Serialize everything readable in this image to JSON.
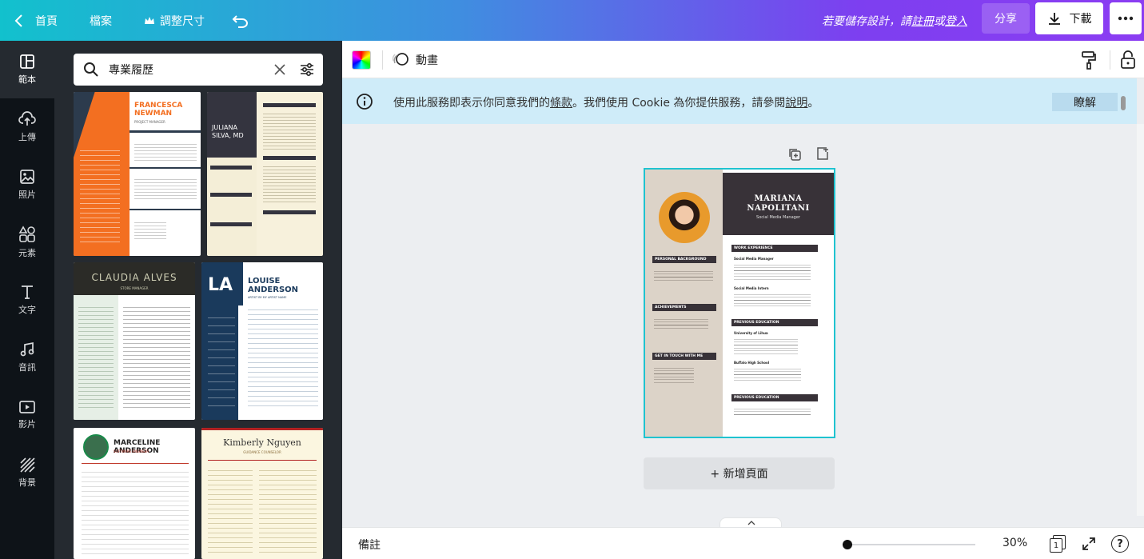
{
  "topbar": {
    "home_label": "首頁",
    "file_label": "檔案",
    "resize_label": "調整尺寸",
    "save_prompt": "若要儲存設計，請",
    "register_label": "註冊",
    "or_label": " 或",
    "login_label": "登入",
    "share_label": "分享",
    "download_label": "下載"
  },
  "rail": {
    "items": [
      {
        "label": "範本",
        "icon": "template-icon"
      },
      {
        "label": "上傳",
        "icon": "upload-icon"
      },
      {
        "label": "照片",
        "icon": "photo-icon"
      },
      {
        "label": "元素",
        "icon": "elements-icon"
      },
      {
        "label": "文字",
        "icon": "text-icon"
      },
      {
        "label": "音訊",
        "icon": "audio-icon"
      },
      {
        "label": "影片",
        "icon": "video-icon"
      },
      {
        "label": "背景",
        "icon": "background-icon"
      }
    ]
  },
  "search": {
    "value": "專業履歷"
  },
  "templates": {
    "t1": {
      "name1": "FRANCESCA",
      "name2": "NEWMAN",
      "role": "PROJECT MANAGER",
      "accent": "#f36f21"
    },
    "t2": {
      "name1": "JULIANA",
      "name2": "SILVA, MD"
    },
    "t3": {
      "name": "CLAUDIA ALVES",
      "role": "STORE MANAGER"
    },
    "t4": {
      "initials": "LA",
      "name1": "LOUISE",
      "name2": "ANDERSON",
      "role": "ARTIST BY MY ARTIST NAME"
    },
    "t5": {
      "name": "MARCELINE ANDERSON",
      "role": "SOFTWARE ENGINEER"
    },
    "t6": {
      "name": "Kimberly Nguyen",
      "role": "GUIDANCE COUNSELOR"
    }
  },
  "toolbar": {
    "animate_label": "動畫"
  },
  "cookie": {
    "text1": "使用此服務即表示你同意我們的",
    "terms_link": "條款",
    "text2": "。我們使用 Cookie 為你提供服務，請參閱",
    "help_link": "說明",
    "text3": "。",
    "ok_label": "瞭解"
  },
  "resume": {
    "name1": "MARIANA",
    "name2": "NAPOLITANI",
    "title": "Social Media Manager",
    "sec_personal": "PERSONAL BACKGROUND",
    "sec_achieve": "ACHIEVEMENTS",
    "sec_contact": "GET IN TOUCH WITH ME",
    "sec_work": "WORK EXPERIENCE",
    "sec_edu": "PREVIOUS EDUCATION",
    "sec_edu2": "PREVIOUS EDUCATION",
    "job1": "Social Media Manager",
    "job2": "Social Media Intern",
    "school1": "University of Lihua",
    "school2": "Buffalo High School"
  },
  "add_page_label": "+ 新增頁面",
  "bottombar": {
    "notes_label": "備註",
    "zoom": "30%",
    "page_count": "1",
    "zoom_fraction": 0.3
  }
}
